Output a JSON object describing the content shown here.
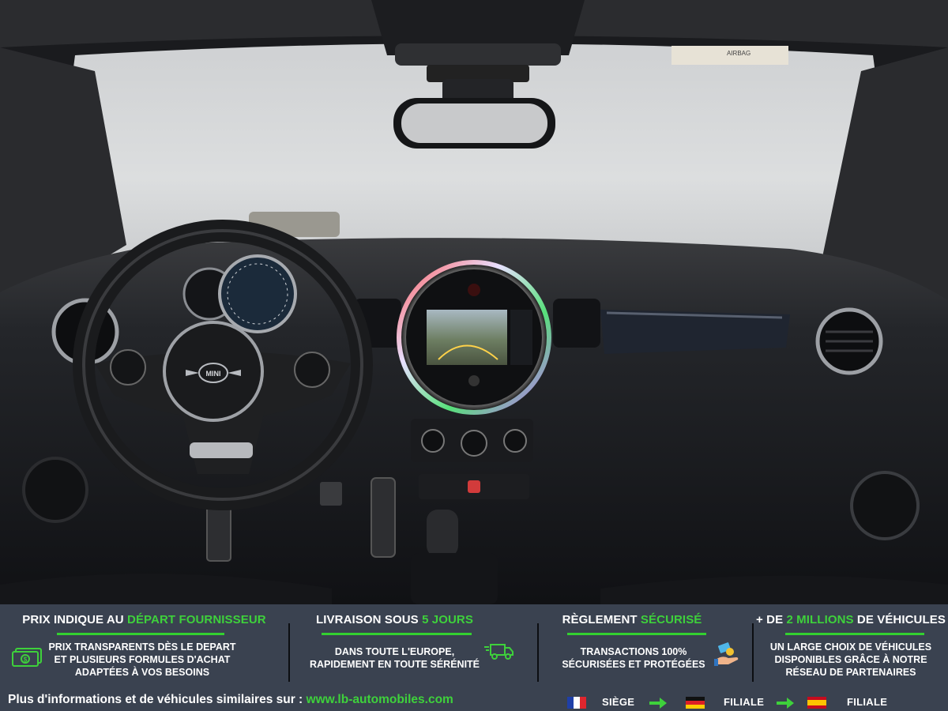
{
  "photo": {
    "subject": "MINI Cooper dashboard interior",
    "steering_badge": "MINI",
    "airbag_label": "AIRBAG"
  },
  "banner": {
    "features": [
      {
        "title_plain": "PRIX INDIQUE AU ",
        "title_accent": "DÉPART FOURNISSEUR",
        "title_after": "",
        "lines": [
          "PRIX TRANSPARENTS DÈS LE DEPART",
          "ET PLUSIEURS FORMULES D'ACHAT",
          "ADAPTÉES À VOS BESOINS"
        ],
        "icon": "money-icon"
      },
      {
        "title_plain": "LIVRAISON SOUS ",
        "title_accent": "5 JOURS",
        "title_after": "",
        "lines": [
          "DANS TOUTE L'EUROPE,",
          "RAPIDEMENT EN TOUTE SÉRÉNITÉ"
        ],
        "icon": "delivery-truck-icon"
      },
      {
        "title_plain": "RÈGLEMENT ",
        "title_accent": "SÉCURISÉ",
        "title_after": "",
        "lines": [
          "TRANSACTIONS 100%",
          "SÉCURISÉES ET PROTÉGÉES"
        ],
        "icon": "payment-hand-icon"
      },
      {
        "title_plain": "+ DE ",
        "title_accent": "2 MILLIONS",
        "title_after": " DE VÉHICULES",
        "lines": [
          "UN LARGE CHOIX DE VÉHICULES",
          "DISPONIBLES GRÂCE À NOTRE",
          "RÉSEAU DE PARTENAIRES"
        ],
        "icon": ""
      }
    ],
    "footer": {
      "text": "Plus d'informations et de véhicules similaires sur : ",
      "url": "www.lb-automobiles.com",
      "locations": [
        {
          "flag": "france-flag-icon",
          "label": "SIÈGE"
        },
        {
          "flag": "germany-flag-icon",
          "label": "FILIALE"
        },
        {
          "flag": "spain-flag-icon",
          "label": "FILIALE"
        }
      ]
    }
  },
  "colors": {
    "banner_bg": "#3a4250",
    "accent_green": "#3ed13b"
  }
}
